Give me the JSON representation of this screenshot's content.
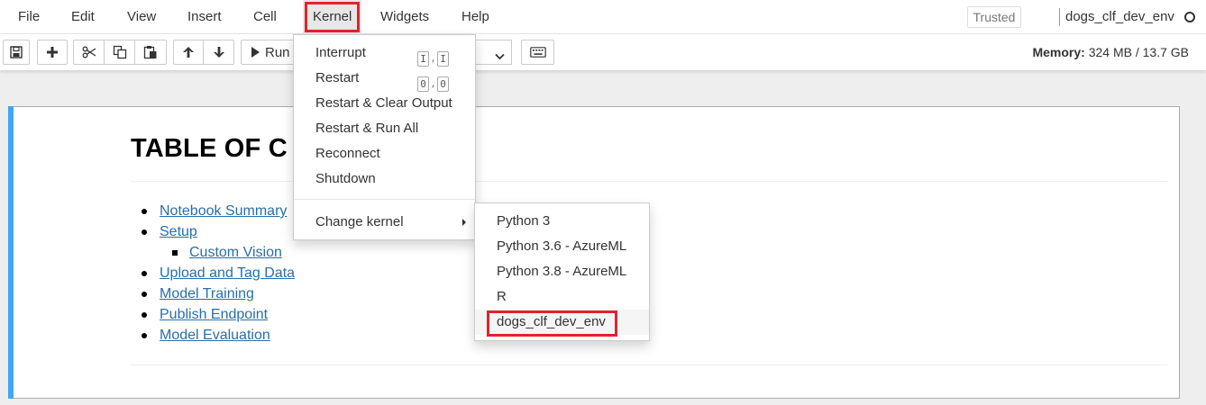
{
  "menubar": {
    "items": [
      {
        "label": "File"
      },
      {
        "label": "Edit"
      },
      {
        "label": "View"
      },
      {
        "label": "Insert"
      },
      {
        "label": "Cell"
      },
      {
        "label": "Kernel"
      },
      {
        "label": "Widgets"
      },
      {
        "label": "Help"
      }
    ],
    "trusted_label": "Trusted",
    "kernel_name": "dogs_clf_dev_env"
  },
  "toolbar": {
    "icons": [
      "save-icon",
      "plus-icon",
      "cut-icon",
      "copy-icon",
      "paste-icon",
      "arrow-up-icon",
      "arrow-down-icon",
      "run-icon",
      "keyboard-icon"
    ],
    "run_label": "Run",
    "memory_label": "Memory:",
    "memory_value": "324 MB / 13.7 GB"
  },
  "notebook": {
    "heading": "TABLE OF C",
    "toc": [
      {
        "label": "Notebook Summary",
        "level": 1
      },
      {
        "label": "Setup",
        "level": 1
      },
      {
        "label": "Custom Vision",
        "level": 2
      },
      {
        "label": "Upload and Tag Data",
        "level": 1
      },
      {
        "label": "Model Training",
        "level": 1
      },
      {
        "label": "Publish Endpoint",
        "level": 1
      },
      {
        "label": "Model Evaluation",
        "level": 1
      }
    ]
  },
  "kernel_menu": {
    "items": [
      {
        "label": "Interrupt",
        "shortcut": [
          "I",
          "I"
        ]
      },
      {
        "label": "Restart",
        "shortcut": [
          "0",
          "0"
        ]
      },
      {
        "label": "Restart & Clear Output"
      },
      {
        "label": "Restart & Run All"
      },
      {
        "label": "Reconnect"
      },
      {
        "label": "Shutdown"
      }
    ],
    "change_kernel_label": "Change kernel"
  },
  "kernel_submenu": {
    "items": [
      {
        "label": "Python 3"
      },
      {
        "label": "Python 3.6 - AzureML"
      },
      {
        "label": "Python 3.8 - AzureML"
      },
      {
        "label": "R"
      },
      {
        "label": "dogs_clf_dev_env"
      }
    ],
    "selected": "dogs_clf_dev_env"
  },
  "colors": {
    "highlight_box": "#e0242b",
    "cell_selected_bar": "#42a5f5",
    "link": "#296eaa"
  }
}
